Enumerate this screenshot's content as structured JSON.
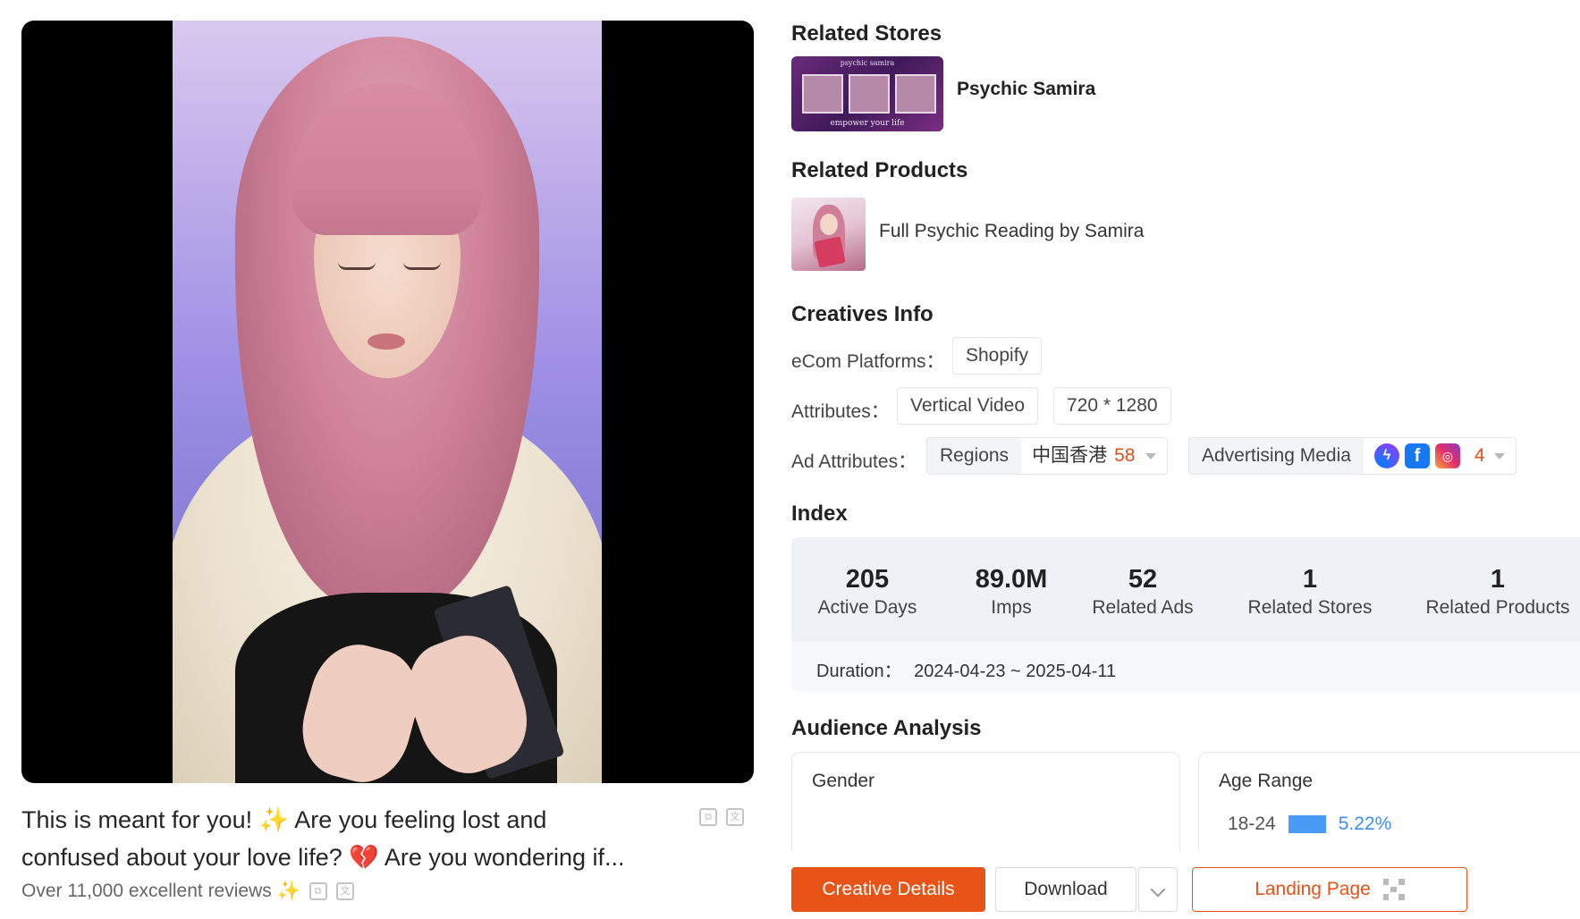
{
  "ad": {
    "caption_line1": "This is meant for you! ✨ Are you feeling lost and",
    "caption_line2": "confused about your love life? 💔 Are you wondering if...",
    "subcaption": "Over 11,000 excellent reviews ✨"
  },
  "related_stores": {
    "heading": "Related Stores",
    "store_name": "Psychic Samira",
    "thumb_top_text": "psychic samira",
    "thumb_bottom_text": "empower your life"
  },
  "related_products": {
    "heading": "Related Products",
    "product_name": "Full Psychic Reading by Samira"
  },
  "creatives_info": {
    "heading": "Creatives Info",
    "ecom_label": "eCom Platforms：",
    "ecom_value": "Shopify",
    "attributes_label": "Attributes：",
    "attributes": [
      "Vertical Video",
      "720 * 1280"
    ],
    "ad_attributes_label": "Ad Attributes：",
    "regions_key": "Regions",
    "regions_value": "中国香港",
    "regions_count": "58",
    "media_key": "Advertising Media",
    "media_icons": [
      "messenger-icon",
      "facebook-icon",
      "instagram-icon"
    ],
    "media_count": "4"
  },
  "index": {
    "heading": "Index",
    "stats": [
      {
        "value": "205",
        "label": "Active Days"
      },
      {
        "value": "89.0M",
        "label": "Imps"
      },
      {
        "value": "52",
        "label": "Related Ads"
      },
      {
        "value": "1",
        "label": "Related Stores"
      },
      {
        "value": "1",
        "label": "Related Products"
      }
    ],
    "duration_label": "Duration：",
    "duration_value": "2024-04-23 ~ 2025-04-11"
  },
  "audience": {
    "heading": "Audience Analysis",
    "gender_title": "Gender",
    "age_title": "Age Range",
    "age_rows": [
      {
        "range": "18-24",
        "percent": "5.22%"
      }
    ]
  },
  "actions": {
    "creative_details": "Creative Details",
    "download": "Download",
    "landing_page": "Landing Page"
  },
  "colors": {
    "accent": "#e85317",
    "bar_blue": "#4a9bf5",
    "count_orange": "#e0501b"
  }
}
